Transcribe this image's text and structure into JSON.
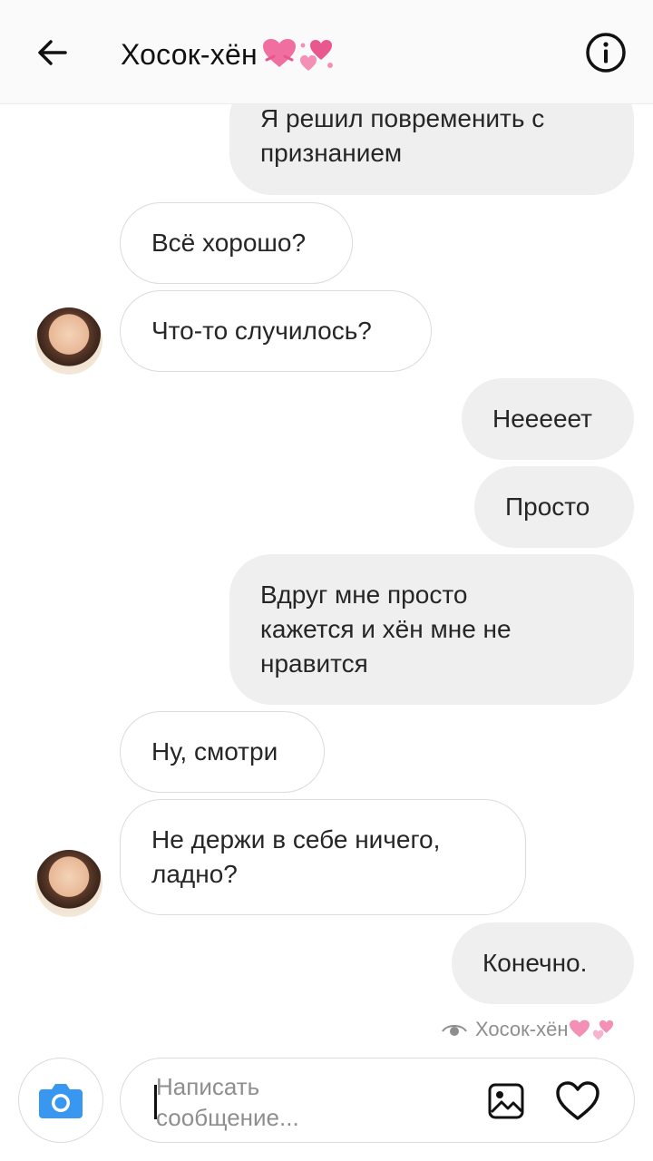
{
  "header": {
    "title": "Хосок-хён",
    "back_icon": "arrow-left-icon",
    "info_icon": "info-circle-icon",
    "title_emojis": [
      "heart-ribbon-emoji",
      "two-hearts-emoji"
    ]
  },
  "messages": [
    {
      "direction": "out",
      "text_lines": [
        "Я решил повременить с",
        "признанием"
      ]
    },
    {
      "direction": "in",
      "text_lines": [
        "Всё хорошо?"
      ]
    },
    {
      "direction": "in",
      "text_lines": [
        "Что-то случилось?"
      ],
      "avatar": true
    },
    {
      "direction": "out",
      "text_lines": [
        "Неееeет"
      ]
    },
    {
      "direction": "out",
      "text_lines": [
        "Просто"
      ]
    },
    {
      "direction": "out",
      "text_lines": [
        "Вдруг мне просто",
        "кажется и хён мне не",
        "нравится"
      ]
    },
    {
      "direction": "in",
      "text_lines": [
        "Ну, смотри"
      ]
    },
    {
      "direction": "in",
      "text_lines": [
        "Не держи в себе ничего,",
        "ладно?"
      ],
      "avatar": true
    },
    {
      "direction": "out",
      "text_lines": [
        "Конечно."
      ]
    }
  ],
  "seen": {
    "label": "Хосок-хён",
    "icon": "eye-icon"
  },
  "composer": {
    "placeholder_line1": "Написать",
    "placeholder_line2": "сообщение...",
    "camera_icon": "camera-icon",
    "gallery_icon": "image-icon",
    "like_icon": "heart-icon"
  },
  "colors": {
    "accent_blue": "#3897f0",
    "bubble_out_bg": "#efefef",
    "bubble_in_border": "#dbdbdb",
    "heart_pink": "#e9578f"
  }
}
